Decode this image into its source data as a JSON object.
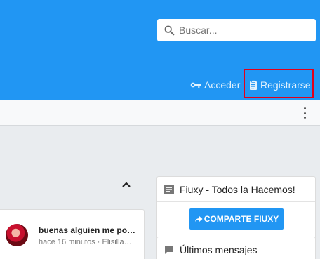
{
  "header": {
    "search": {
      "placeholder": "Buscar...",
      "value": ""
    },
    "auth": {
      "login_label": "Acceder",
      "register_label": "Registrarse"
    },
    "highlight_color": "#e2001a",
    "background_color": "#2196f3"
  },
  "subbar": {
    "menu_icon": "more-vert-icon"
  },
  "feed": {
    "collapse_icon": "chevron-up-icon",
    "items": [
      {
        "title": "buenas alguien me podrí…",
        "meta": "hace 16 minutos · Elisilla…"
      }
    ]
  },
  "sidebar": {
    "widget_title": "Fiuxy - Todos la Hacemos!",
    "share_button_label": "COMPARTE FIUXY",
    "messages_title": "Últimos mensajes"
  }
}
